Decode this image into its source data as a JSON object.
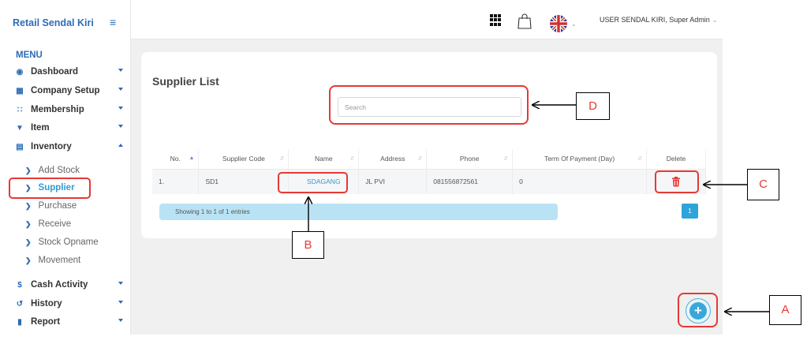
{
  "app": {
    "brand": "Retail Sendal Kiri"
  },
  "header": {
    "user": "USER SENDAL KIRI, Super Admin"
  },
  "menu": {
    "title": "MENU",
    "items": [
      {
        "label": "Dashboard",
        "icon": "dashboard-icon"
      },
      {
        "label": "Company Setup",
        "icon": "building-icon"
      },
      {
        "label": "Membership",
        "icon": "users-icon"
      },
      {
        "label": "Item",
        "icon": "cart-icon"
      },
      {
        "label": "Inventory",
        "icon": "inventory-icon"
      }
    ],
    "inventory_sub": [
      "Add Stock",
      "Supplier",
      "Purchase",
      "Receive",
      "Stock Opname",
      "Movement"
    ],
    "items_after": [
      {
        "label": "Cash Activity",
        "icon": "dollar-icon"
      },
      {
        "label": "History",
        "icon": "history-icon"
      },
      {
        "label": "Report",
        "icon": "report-icon"
      }
    ]
  },
  "main": {
    "title": "Supplier List",
    "search": {
      "placeholder": "Search",
      "value": ""
    },
    "table": {
      "columns": [
        "No.",
        "Supplier Code",
        "Name",
        "Address",
        "Phone",
        "Term Of Payment (Day)",
        "Delete"
      ],
      "rows": [
        {
          "no": "1.",
          "code": "SD1",
          "name": "SDAGANG",
          "address": "JL PVI",
          "phone": "081556872561",
          "term": "0"
        }
      ]
    },
    "info": "Showing 1 to 1 of 1 entries",
    "page": "1"
  },
  "callouts": {
    "a": "A",
    "b": "B",
    "c": "C",
    "d": "D"
  },
  "colors": {
    "accent": "#2d6cb5",
    "highlight": "#e53935",
    "link": "#2d9bd6"
  }
}
